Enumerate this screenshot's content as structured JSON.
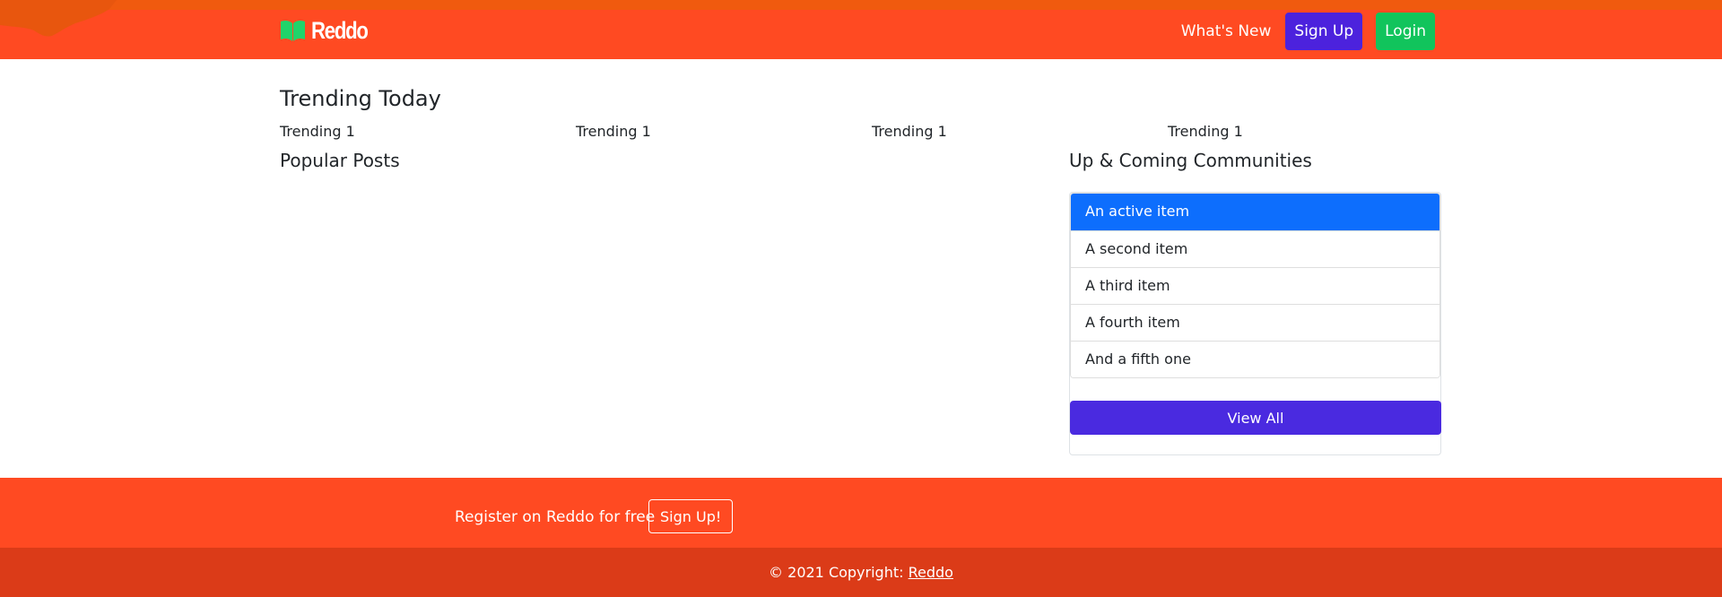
{
  "colors": {
    "navbar": "#ff4a22",
    "navbar_stripe": "#f05a0f",
    "brand_icon": "#1fd46a",
    "primary_purple": "#4c22dd",
    "login_green": "#11c45c",
    "active_item_blue": "#0d6efd",
    "footer_register": "#ff4a22",
    "footer_copyright": "#db3b18"
  },
  "navbar": {
    "brand": {
      "icon": "open-book-icon",
      "name": "Reddo"
    },
    "whats_new": "What's New",
    "signup": "Sign Up",
    "login": "Login"
  },
  "main": {
    "title": "Trending Today",
    "trending": [
      "Trending 1",
      "Trending 1",
      "Trending 1",
      "Trending 1"
    ],
    "popular_posts_title": "Popular Posts"
  },
  "sidebar": {
    "title": "Up & Coming Communities",
    "items": [
      "An active item",
      "A second item",
      "A third item",
      "A fourth item",
      "And a fifth one"
    ],
    "active_index": 0,
    "view_all": "View All"
  },
  "footer": {
    "register_text": "Register on Reddo for free",
    "signup_button": "Sign Up!",
    "copyright_prefix": "© 2021 Copyright:",
    "copyright_link": "Reddo"
  }
}
